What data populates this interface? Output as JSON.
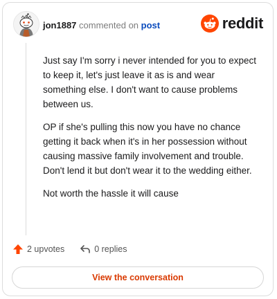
{
  "comment": {
    "username": "jon1887",
    "action_text": "commented on",
    "post_link": "post",
    "paragraphs": [
      "Just say I'm sorry i never intended for you to expect to keep it, let's just leave it as is and wear something else. I don't want to cause problems between us.",
      "OP if she's pulling this now you have no chance getting it back when it's in her possession without causing massive family involvement and trouble. Don't lend it but don't wear it to the wedding either.",
      "Not worth the hassle it will cause"
    ]
  },
  "brand": {
    "wordmark": "reddit",
    "icon": "reddit-logo-icon",
    "color": "#ff4500"
  },
  "actions": {
    "upvotes": "2 upvotes",
    "replies": "0 replies",
    "upvote_icon": "upvote-arrow-icon",
    "reply_icon": "reply-arrow-icon",
    "upvote_color": "#ff4500"
  },
  "cta": {
    "label": "View the conversation",
    "color": "#d93900"
  }
}
